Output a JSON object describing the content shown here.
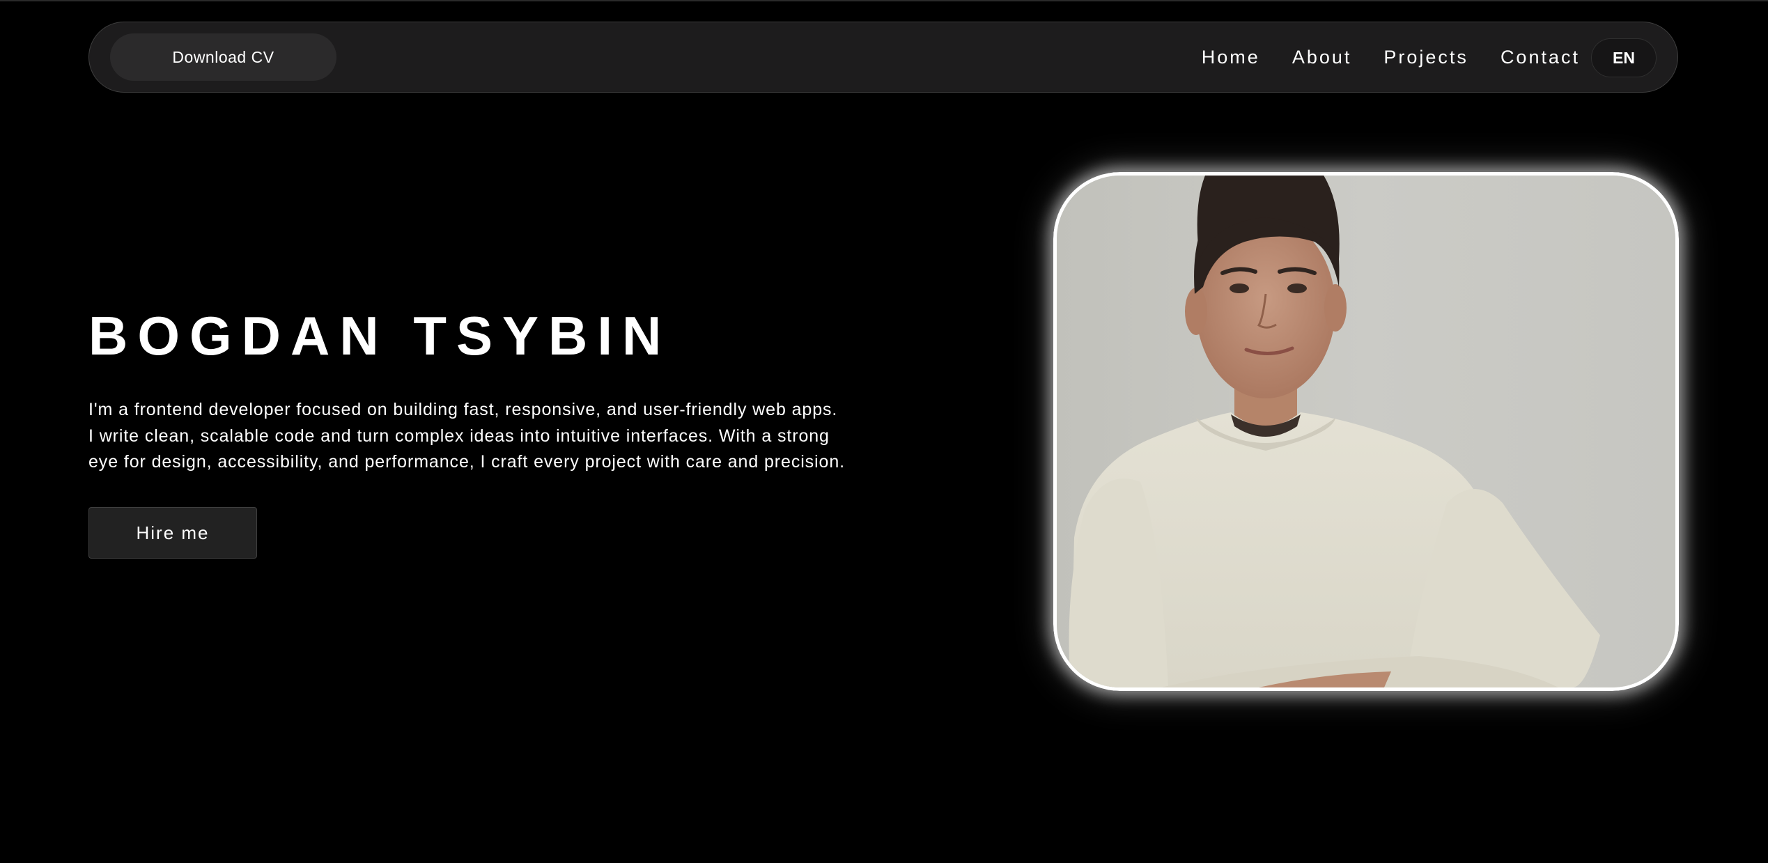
{
  "nav": {
    "download_cv": "Download CV",
    "links": [
      "Home",
      "About",
      "Projects",
      "Contact"
    ],
    "language": "EN"
  },
  "hero": {
    "name": "BOGDAN TSYBIN",
    "description_lines": [
      "I'm a frontend developer focused on building fast, responsive, and user-friendly web apps.",
      "I write clean, scalable code and turn complex ideas into intuitive interfaces. With a strong",
      "eye for design, accessibility, and performance, I craft every project with care and precision."
    ],
    "hire_button": "Hire me"
  },
  "portrait": {
    "icon": "portrait-photo"
  },
  "colors": {
    "background": "#000000",
    "navbar": "#1d1c1d",
    "button": "#222222",
    "text": "#ffffff",
    "photo_border": "#ffffff"
  }
}
